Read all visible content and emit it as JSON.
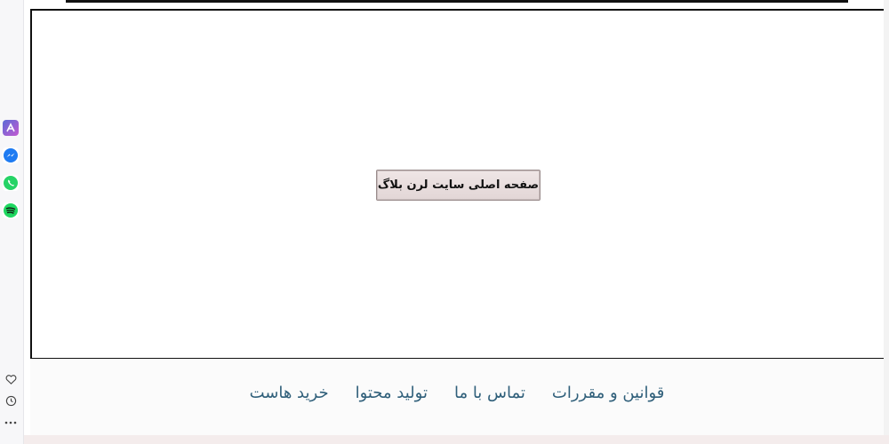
{
  "dock": {
    "apps": [
      {
        "icon": "arc-app-icon",
        "glyph": "⋀"
      },
      {
        "icon": "messenger-icon",
        "glyph": "⚡"
      },
      {
        "icon": "whatsapp-icon",
        "glyph": "✆"
      },
      {
        "icon": "spotify-icon",
        "glyph": "≋"
      }
    ],
    "bottom": [
      {
        "icon": "heart-icon",
        "glyph": "♡"
      },
      {
        "icon": "clock-icon",
        "glyph": "◷"
      },
      {
        "icon": "more-icon",
        "glyph": "···"
      }
    ]
  },
  "main": {
    "home_button_label": "صفحه اصلی سایت لرن بلاگ"
  },
  "footer": {
    "links": [
      "قوانین و مقررات",
      "تماس با ما",
      "تولید محتوا",
      "خرید هاست"
    ]
  }
}
